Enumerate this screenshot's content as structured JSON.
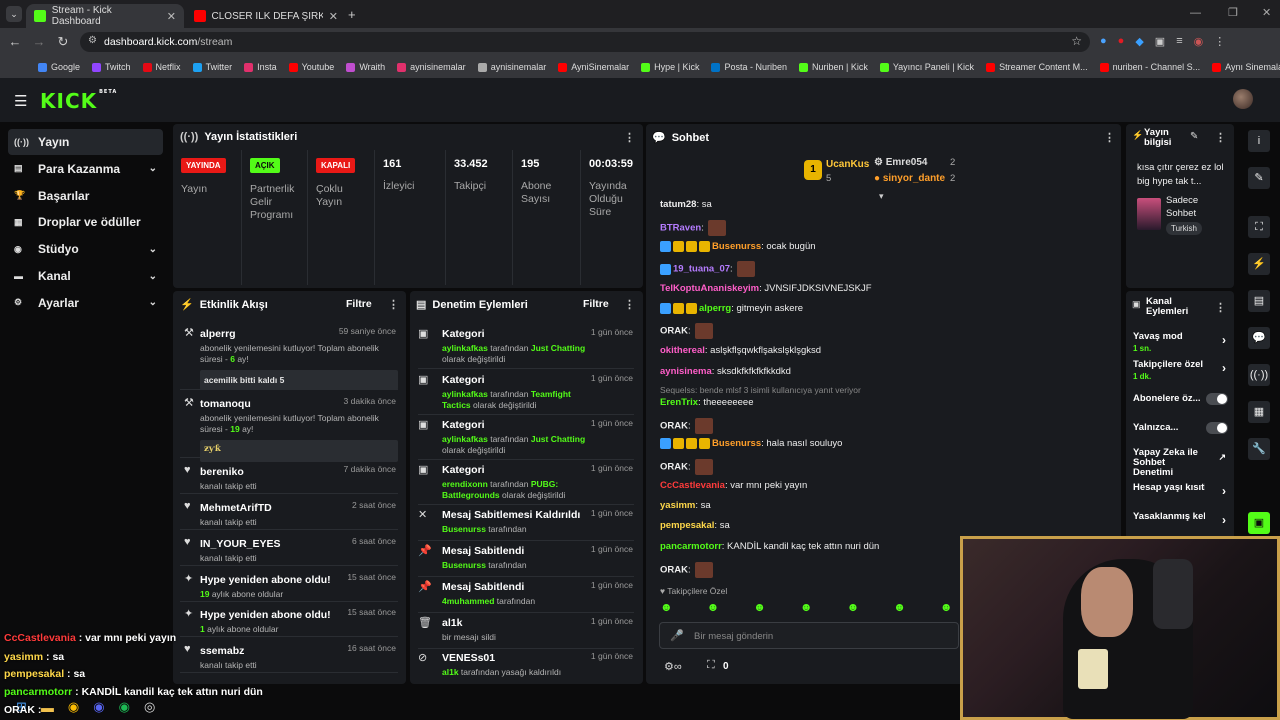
{
  "browser": {
    "tabs": [
      {
        "title": "Stream - Kick Dashboard",
        "active": true
      },
      {
        "title": "CLOSER İLK DEFA ŞİRKETİN OĞ…",
        "active": false
      }
    ],
    "url_domain": "dashboard.kick.com",
    "url_path": "/stream",
    "bookmarks": [
      "Google",
      "Twitch",
      "Netflix",
      "Twitter",
      "Insta",
      "Youtube",
      "Wraith",
      "aynisinemalar",
      "aynisinemalar",
      "AyniSinemalar",
      "Hype | Kick",
      "Posta - Nuriben",
      "Nuriben | Kick",
      "Yayıncı Paneli | Kick",
      "Streamer Content M...",
      "nuriben - Channel S...",
      "Aynı Sinemalar - Ça..."
    ]
  },
  "app": {
    "logo": "KICK",
    "logo_tag": "BETA",
    "accent": "#53fc18",
    "sidebar": [
      {
        "label": "Yayın",
        "icon": "broadcast-icon",
        "active": true,
        "chev": false
      },
      {
        "label": "Para Kazanma",
        "icon": "money-icon",
        "chev": true
      },
      {
        "label": "Başarılar",
        "icon": "trophy-icon",
        "chev": false
      },
      {
        "label": "Droplar ve ödüller",
        "icon": "gift-icon",
        "chev": false
      },
      {
        "label": "Stüdyo",
        "icon": "studio-icon",
        "chev": true
      },
      {
        "label": "Kanal",
        "icon": "channel-icon",
        "chev": true
      },
      {
        "label": "Ayarlar",
        "icon": "gear-icon",
        "chev": true
      }
    ]
  },
  "stats": {
    "title": "Yayın İstatistikleri",
    "cols": [
      {
        "badge": "YAYINDA",
        "badge_color": "#e91916",
        "label": "Yayın"
      },
      {
        "badge": "AÇIK",
        "badge_color": "#53fc18",
        "label": "Partnerlik Gelir Programı"
      },
      {
        "badge": "KAPALI",
        "badge_color": "#e91916",
        "label": "Çoklu Yayın"
      },
      {
        "value": "161",
        "label": "İzleyici"
      },
      {
        "value": "33.452",
        "label": "Takipçi"
      },
      {
        "value": "195",
        "label": "Abone Sayısı"
      },
      {
        "value": "00:03:59",
        "label": "Yayında Olduğu Süre"
      }
    ]
  },
  "activity": {
    "title": "Etkinlik Akışı",
    "filter": "Filtre",
    "items": [
      {
        "name": "alperrg",
        "time": "59 saniye önce",
        "text1": "abonelik yenilemesini kutluyor! Toplam abonelik süresi - ",
        "num": "6",
        "text2": " ay!",
        "note": "acemilik bitti kaldı 5"
      },
      {
        "name": "tomanoqu",
        "time": "3 dakika önce",
        "text1": "abonelik yenilemesini kutluyor! Toplam abonelik süresi - ",
        "num": "19",
        "text2": " ay!",
        "note": "ƶƴƙ"
      },
      {
        "name": "bereniko",
        "time": "7 dakika önce",
        "sub": "kanalı takip etti"
      },
      {
        "name": "MehmetArifTD",
        "time": "2 saat önce",
        "sub": "kanalı takip etti"
      },
      {
        "name": "IN_YOUR_EYES",
        "time": "6 saat önce",
        "sub": "kanalı takip etti"
      },
      {
        "name": "Hype yeniden abone oldu!",
        "time": "15 saat önce",
        "num": "19",
        "sub": " aylık abone oldular"
      },
      {
        "name": "Hype yeniden abone oldu!",
        "time": "15 saat önce",
        "num": "1",
        "sub": " aylık abone oldular"
      },
      {
        "name": "ssemabz",
        "time": "16 saat önce",
        "sub": "kanalı takip etti"
      }
    ]
  },
  "moderation": {
    "title": "Denetim Eylemleri",
    "filter": "Filtre",
    "items": [
      {
        "title": "Kategori",
        "time": "1 gün önce",
        "actor": "aylinkafkas",
        "mid": " tarafından ",
        "target": "Just Chatting",
        "end": " olarak değiştirildi"
      },
      {
        "title": "Kategori",
        "time": "1 gün önce",
        "actor": "aylinkafkas",
        "mid": " tarafından ",
        "target": "Teamfight Tactics",
        "end": " olarak değiştirildi"
      },
      {
        "title": "Kategori",
        "time": "1 gün önce",
        "actor": "aylinkafkas",
        "mid": " tarafından ",
        "target": "Just Chatting",
        "end": " olarak değiştirildi"
      },
      {
        "title": "Kategori",
        "time": "1 gün önce",
        "actor": "erendixonn",
        "mid": " tarafından ",
        "target": "PUBG: Battlegrounds",
        "end": " olarak değiştirildi"
      },
      {
        "title": "Mesaj Sabitlemesi Kaldırıldı",
        "time": "1 gün önce",
        "actor": "Busenurss",
        "end": " tarafından"
      },
      {
        "title": "Mesaj Sabitlendi",
        "time": "1 gün önce",
        "actor": "Busenurss",
        "end": " tarafından"
      },
      {
        "title": "Mesaj Sabitlendi",
        "time": "1 gün önce",
        "actor": "4muhammed",
        "end": " tarafından"
      },
      {
        "title": "al1k",
        "time": "1 gün önce",
        "plain": "bir mesajı sildi"
      },
      {
        "title": "VENESs01",
        "time": "1 gün önce",
        "actor": "al1k",
        "end": " tarafından yasağı kaldırıldı"
      }
    ]
  },
  "chat": {
    "title": "Sohbet",
    "leaderboard": [
      {
        "name": "UcanKus",
        "count": "5",
        "rank": "1"
      },
      {
        "name": "Emre054",
        "count": "2"
      },
      {
        "name": "sinyor_dante",
        "count": "2"
      }
    ],
    "messages": [
      {
        "user": "tatum28",
        "color": "#eeeeee",
        "text": "sa"
      },
      {
        "user": "BTRaven",
        "color": "#b57cff",
        "text": "",
        "emote": true
      },
      {
        "user": "Busenurss",
        "color": "#ff9f2a",
        "text": "ocak bugün",
        "badges": 4
      },
      {
        "user": "19_tuana_07",
        "color": "#b57cff",
        "text": "",
        "emote": true,
        "badges": 1
      },
      {
        "user": "TelKoptuAnaniskeyim",
        "color": "#ff5ec9",
        "text": "JVNSIFJDKSIVNEJSKJF"
      },
      {
        "user": "alperrg",
        "color": "#53fc18",
        "text": "gitmeyin askere",
        "badges": 3
      },
      {
        "user": "ORAK",
        "color": "#eeeeee",
        "text": "",
        "emote": true
      },
      {
        "user": "okithereal",
        "color": "#ff5ec9",
        "text": "aslşkflşqwkflşakslşklşgksd"
      },
      {
        "user": "aynisinema",
        "color": "#ff5ec9",
        "text": "sksdkfkfkfkfkkdkd"
      },
      {
        "reply": "Sequelss: bende mlsf 3 isimli kullanıcıya yanıt veriyor"
      },
      {
        "user": "ErenTrix",
        "color": "#53fc18",
        "text": "theeeeeeee"
      },
      {
        "user": "ORAK",
        "color": "#eeeeee",
        "text": "",
        "emote": true
      },
      {
        "user": "Busenurss",
        "color": "#ff9f2a",
        "text": "hala nasıl souluyo",
        "badges": 4
      },
      {
        "user": "ORAK",
        "color": "#eeeeee",
        "text": "",
        "emote": true
      },
      {
        "user": "CcCastlevania",
        "color": "#ff3b3b",
        "text": "var mnı peki yayın"
      },
      {
        "user": "yasimm",
        "color": "#ffd84a",
        "text": "sa"
      },
      {
        "user": "pempesakal",
        "color": "#ffd84a",
        "text": "sa"
      },
      {
        "user": "pancarmotorr",
        "color": "#53fc18",
        "text": "KANDİL kandil kaç tek attın nuri dün"
      },
      {
        "user": "ORAK",
        "color": "#eeeeee",
        "text": "",
        "emote": true
      }
    ],
    "follower_only": "Takipçilere Özel",
    "input_placeholder": "Bir mesaj gönderin",
    "counter": "0"
  },
  "stream_info": {
    "title": "Yayın bilgisi",
    "desc": "kısa çıtır çerez ez lol big hype tak t...",
    "category": "Sadece Sohbet",
    "tag": "Turkish"
  },
  "channel_actions": {
    "title": "Kanal Eylemleri",
    "items": [
      {
        "label": "Yavaş mod",
        "value": "1 sn.",
        "type": "chev"
      },
      {
        "label": "Takipçilere özel s",
        "value": "1 dk.",
        "type": "chev"
      },
      {
        "label": "Abonelere öz...",
        "type": "toggle"
      },
      {
        "label": "Yalnızca...",
        "type": "toggle"
      },
      {
        "label": "Yapay Zeka ile Sohbet Denetimi",
        "type": "ext"
      },
      {
        "label": "Hesap yaşı kısıtla",
        "type": "chev"
      },
      {
        "label": "Yasaklanmış kelin",
        "type": "chev"
      }
    ]
  },
  "overlay_chat": [
    {
      "user": "CcCastlevania",
      "color": "#ff3b3b",
      "text": " : var mnı peki yayın"
    },
    {
      "user": "yasimm",
      "color": "#ffd84a",
      "text": " : sa"
    },
    {
      "user": "pempesakal",
      "color": "#ffd84a",
      "text": " : sa"
    },
    {
      "user": "pancarmotorr",
      "color": "#53fc18",
      "text": " : KANDİL kandil kaç tek attın nuri dün"
    },
    {
      "user": "ORAK",
      "color": "#ffffff",
      "text": " :"
    }
  ]
}
